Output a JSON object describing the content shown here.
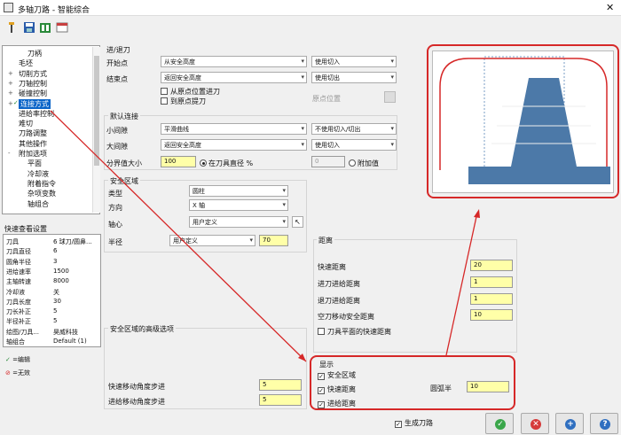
{
  "window": {
    "title": "多轴刀路 - 智能综合",
    "close_glyph": "✕"
  },
  "toolbar": {
    "icons": [
      "wand-icon",
      "save-icon",
      "export-icon",
      "window-icon"
    ]
  },
  "tree": {
    "items": [
      {
        "label": "刀柄",
        "indent": 2
      },
      {
        "label": "毛坯",
        "indent": 1
      },
      {
        "label": "切削方式",
        "indent": 1,
        "expander": "+"
      },
      {
        "label": "刀轴控制",
        "indent": 1,
        "expander": "+"
      },
      {
        "label": "碰撞控制",
        "indent": 1,
        "expander": "+"
      },
      {
        "label": "连接方式",
        "indent": 1,
        "expander": "+",
        "selected": true,
        "check": "✓"
      },
      {
        "label": "进给率控制",
        "indent": 1
      },
      {
        "label": "难切",
        "indent": 1
      },
      {
        "label": "刀路调整",
        "indent": 1
      },
      {
        "label": "其他操作",
        "indent": 1
      },
      {
        "label": "附加选项",
        "indent": 1,
        "expander": "-"
      },
      {
        "label": "平面",
        "indent": 2
      },
      {
        "label": "冷却液",
        "indent": 2
      },
      {
        "label": "附着指令",
        "indent": 2
      },
      {
        "label": "杂项变数",
        "indent": 2
      },
      {
        "label": "轴组合",
        "indent": 2
      }
    ]
  },
  "quick": {
    "title": "快速查看设置",
    "rows": [
      {
        "k": "刀具",
        "v": "6 球刀/圆鼻..."
      },
      {
        "k": "刀具直径",
        "v": "6"
      },
      {
        "k": "圆角半径",
        "v": "3"
      },
      {
        "k": "进给速率",
        "v": "1500"
      },
      {
        "k": "主轴转速",
        "v": "8000"
      },
      {
        "k": "冷却液",
        "v": "关"
      },
      {
        "k": "刀具长度",
        "v": "30"
      },
      {
        "k": "刀长补正",
        "v": "5"
      },
      {
        "k": "半径补正",
        "v": "5"
      },
      {
        "k": "绘图/刀具...",
        "v": "昊威科技"
      },
      {
        "k": "轴组合",
        "v": "Default (1)"
      }
    ],
    "legend_edit": "=编辑",
    "legend_invalid": "=无效",
    "legend_edit_icon": "✓",
    "legend_invalid_icon": "⊘"
  },
  "entry_exit": {
    "title": "进/退刀",
    "start_label": "开始点",
    "start_value": "从安全高度",
    "start_mode": "使用切入",
    "end_label": "结束点",
    "end_value": "返回安全高度",
    "end_mode": "使用切出",
    "cb_from_origin": "从原点位置进刀",
    "cb_to_origin": "到原点提刀",
    "origin_label": "原点位置"
  },
  "default_link": {
    "title": "默认连接",
    "small_label": "小间隙",
    "small_value": "平滑曲线",
    "small_mode": "不使用切入/切出",
    "large_label": "大间隙",
    "large_value": "返回安全高度",
    "large_mode": "使用切入",
    "gap_label": "分界值大小",
    "gap_value": "100",
    "radio_pct": "在刀具直径 %",
    "disabled_value": "0",
    "radio_abs": "附加值"
  },
  "safe_zone": {
    "title": "安全区域",
    "type_label": "类型",
    "type_value": "圆柱",
    "dir_label": "方向",
    "dir_value": "X 轴",
    "axis_label": "轴心",
    "axis_value": "用户定义",
    "radius_label": "半径",
    "radius_mode": "用户定义",
    "radius_value": "70"
  },
  "safe_zone_adv": {
    "title": "安全区域的高级选项",
    "rapid_label": "快速移动角度步进",
    "rapid_value": "5",
    "feed_label": "进给移动角度步进",
    "feed_value": "5"
  },
  "distance": {
    "title": "距离",
    "rapid_label": "快速距离",
    "rapid_value": "20",
    "feed_in_label": "进刀进给距离",
    "feed_in_value": "1",
    "feed_out_label": "退刀进给距离",
    "feed_out_value": "1",
    "clear_label": "空刀移动安全距离",
    "clear_value": "10",
    "tool_plane_label": "刀具平面的快速距离"
  },
  "display": {
    "title": "显示",
    "safe_area": "安全区域",
    "rapid_dist": "快速距离",
    "feed_dist": "进给距离",
    "radius_label": "圆弧半",
    "radius_value": "10"
  },
  "bottom": {
    "generate": "生成刀路",
    "ok_glyph": "✓",
    "cancel_glyph": "✕",
    "add_glyph": "+",
    "help_glyph": "?"
  },
  "colors": {
    "accent_red": "#d62828",
    "selected_blue": "#0a64c8",
    "input_yellow": "#ffffa8",
    "part_blue": "#4c79a8"
  }
}
